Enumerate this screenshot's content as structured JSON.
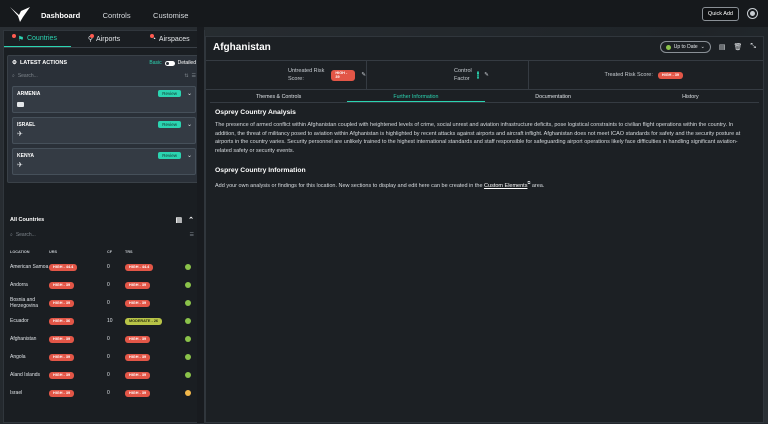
{
  "topbar": {
    "nav": [
      "Dashboard",
      "Controls",
      "Customise"
    ],
    "quick_add": "Quick Add"
  },
  "left_tabs": [
    "Countries",
    "Airports",
    "Airspaces"
  ],
  "latest_actions": {
    "title": "LATEST ACTIONS",
    "toggle_basic": "Basic",
    "toggle_detailed": "Detailed",
    "search_placeholder": "Search...",
    "review_label": "Review",
    "cards": [
      {
        "name": "ARMENIA"
      },
      {
        "name": "ISRAEL"
      },
      {
        "name": "KENYA"
      }
    ]
  },
  "all_countries": {
    "title": "All Countries",
    "search_placeholder": "Search...",
    "columns": [
      "LOCATION",
      "URS",
      "CF",
      "TRS"
    ],
    "rows": [
      {
        "location": "American Samoa",
        "urs": "HIGH - 44.4",
        "cf": "0",
        "trs": "HIGH - 44.4",
        "trs_level": "high",
        "status": "#8bc34a"
      },
      {
        "location": "Andorra",
        "urs": "HIGH - 39",
        "cf": "0",
        "trs": "HIGH - 39",
        "trs_level": "high",
        "status": "#8bc34a"
      },
      {
        "location": "Bosnia and Herzegovina",
        "urs": "HIGH - 39",
        "cf": "0",
        "trs": "HIGH - 39",
        "trs_level": "high",
        "status": "#8bc34a"
      },
      {
        "location": "Ecuador",
        "urs": "HIGH - 36",
        "cf": "10",
        "trs": "MODERATE - 26",
        "trs_level": "moderate",
        "status": "#8bc34a"
      },
      {
        "location": "Afghanistan",
        "urs": "HIGH - 39",
        "cf": "0",
        "trs": "HIGH - 39",
        "trs_level": "high",
        "status": "#8bc34a"
      },
      {
        "location": "Angola",
        "urs": "HIGH - 39",
        "cf": "0",
        "trs": "HIGH - 39",
        "trs_level": "high",
        "status": "#8bc34a"
      },
      {
        "location": "Aland Islands",
        "urs": "HIGH - 39",
        "cf": "0",
        "trs": "HIGH - 39",
        "trs_level": "high",
        "status": "#8bc34a"
      },
      {
        "location": "Israel",
        "urs": "HIGH - 39",
        "cf": "0",
        "trs": "HIGH - 39",
        "trs_level": "high",
        "status": "#f2b84b"
      }
    ]
  },
  "detail": {
    "title": "Afghanistan",
    "up_to_date": "Up to Date",
    "untreated_label": "Untreated Risk Score:",
    "untreated_value": "HIGH - 39",
    "control_label": "Control Factor",
    "control_value": "0",
    "treated_label": "Treated Risk Score:",
    "treated_value": "HIGH - 39",
    "tabs": [
      "Themes & Controls",
      "Further Information",
      "Documentation",
      "History"
    ],
    "section1_title": "Osprey Country Analysis",
    "section1_body": "The presence of armed conflict within Afghanistan coupled with heightened levels of crime, social unrest and aviation infrastructure deficits, pose logistical constraints to civilian flight operations within the country. In addition, the threat of militancy posed to aviation within Afghanistan is highlighted by recent attacks against airports and aircraft inflight. Afghanistan does not meet ICAO standards for safety and the security posture at airports in the country varies. Security personnel are unlikely trained to the highest international standards and staff responsible for safeguarding airport operations likely face difficulties in handling significant aviation-related safety or security events.",
    "section2_title": "Osprey Country Information",
    "section2_pre": "Add your own analysis or findings for this location. New sections to display and edit here can be created in the",
    "section2_link": "Custom Elements",
    "section2_post": "area."
  },
  "colors": {
    "accent": "#2bd4b1",
    "high": "#e25647",
    "moderate": "#b8c447"
  }
}
